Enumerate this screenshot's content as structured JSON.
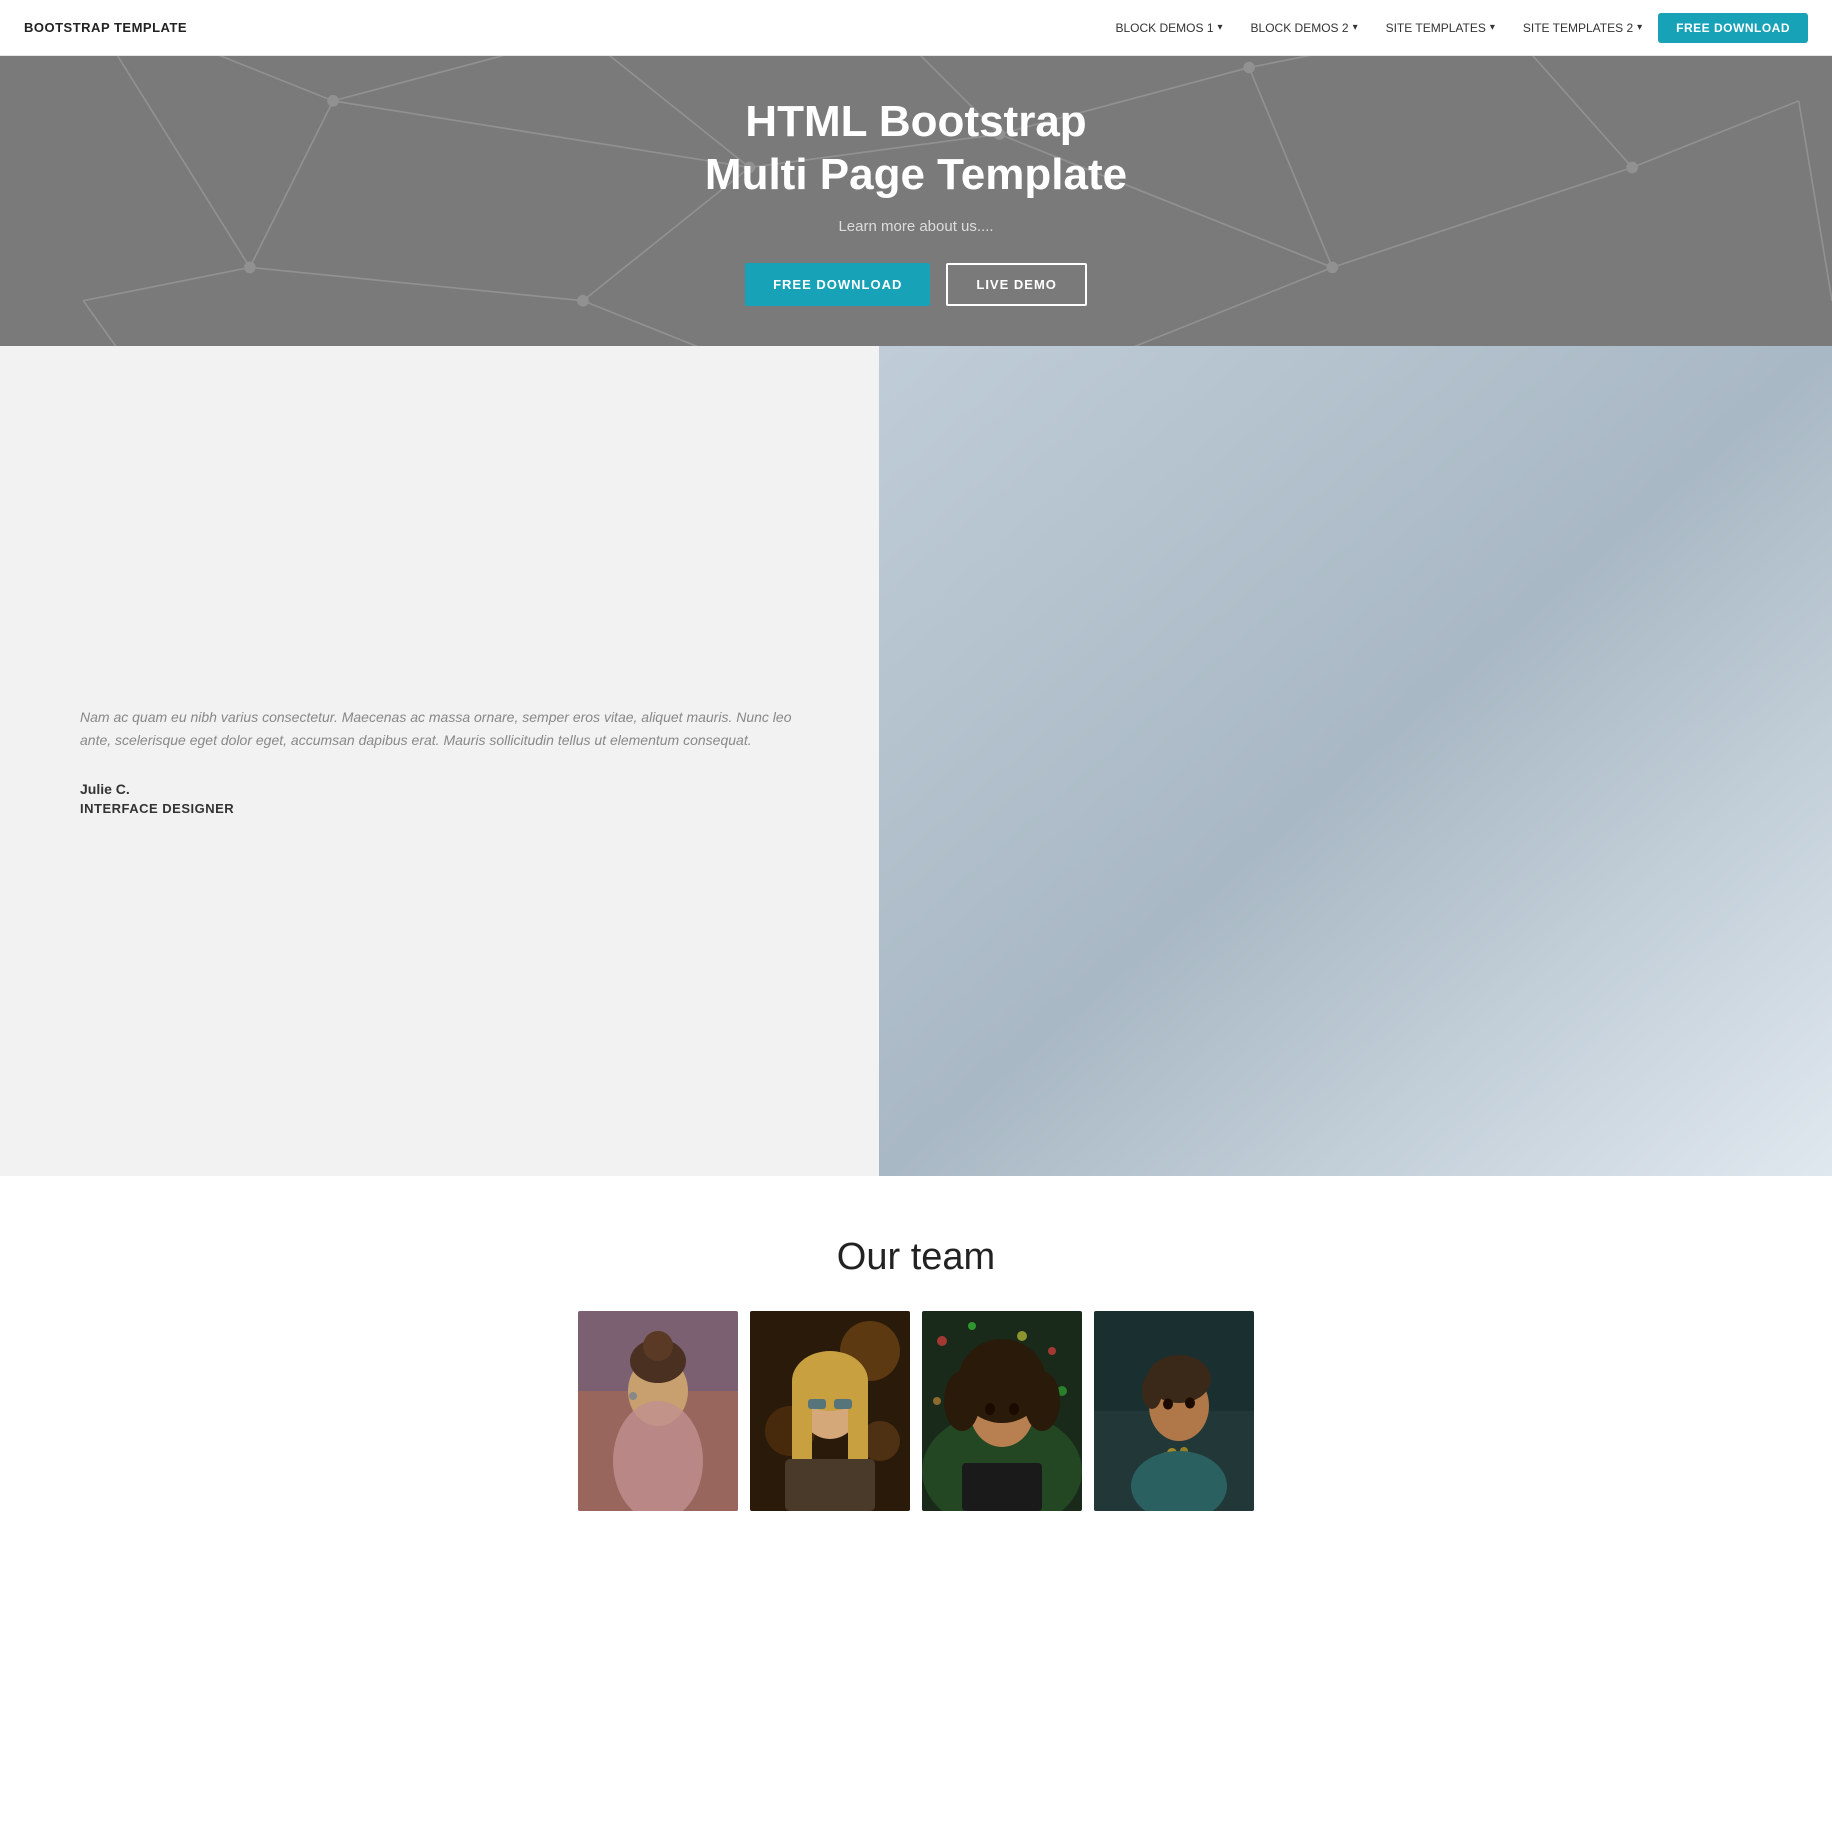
{
  "navbar": {
    "brand": "BOOTSTRAP TEMPLATE",
    "links": [
      {
        "label": "BLOCK DEMOS 1",
        "has_dropdown": true
      },
      {
        "label": "BLOCK DEMOS 2",
        "has_dropdown": true
      },
      {
        "label": "SITE TEMPLATES",
        "has_dropdown": true
      },
      {
        "label": "SITE TEMPLATES 2",
        "has_dropdown": true
      }
    ],
    "cta_button": "FREE DOWNLOAD"
  },
  "hero": {
    "title_line1": "HTML Bootstrap",
    "title_line2": "Multi Page Template",
    "subtitle": "Learn more about us....",
    "btn_primary": "FREE DOWNLOAD",
    "btn_secondary": "LIVE DEMO"
  },
  "about": {
    "quote": "Nam ac quam eu nibh varius consectetur. Maecenas ac massa ornare, semper eros vitae, aliquet mauris. Nunc leo ante, scelerisque eget dolor eget, accumsan dapibus erat. Mauris sollicitudin tellus ut elementum consequat.",
    "author": "Julie C.",
    "role": "INTERFACE DESIGNER"
  },
  "team": {
    "title": "Our team",
    "members": [
      {
        "id": 1,
        "color_class": "team-card-1"
      },
      {
        "id": 2,
        "color_class": "team-card-2"
      },
      {
        "id": 3,
        "color_class": "team-card-3"
      },
      {
        "id": 4,
        "color_class": "team-card-4"
      }
    ]
  },
  "colors": {
    "accent": "#17a2b8",
    "nav_bg": "#ffffff",
    "hero_bg": "#888888",
    "section_bg": "#f2f2f2",
    "white": "#ffffff"
  }
}
